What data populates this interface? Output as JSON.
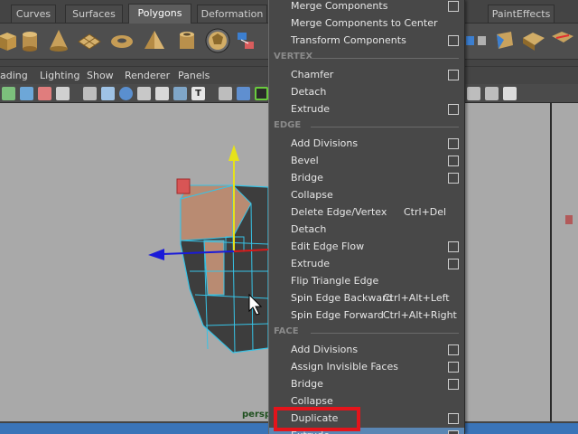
{
  "shelf": {
    "tabs": [
      "Curves",
      "Surfaces",
      "Polygons",
      "Deformation",
      "PaintEffects"
    ],
    "active_tab": "Polygons"
  },
  "panel_menu": [
    "ading",
    "Lighting",
    "Show",
    "Renderer",
    "Panels"
  ],
  "viewport": {
    "camera": "persp"
  },
  "menu": {
    "items": [
      {
        "label": "Merge Components",
        "option_box": true
      },
      {
        "label": "Merge Components to Center",
        "option_box": false
      },
      {
        "label": "Transform Components",
        "option_box": true
      },
      {
        "section": "VERTEX"
      },
      {
        "label": "Chamfer",
        "option_box": true
      },
      {
        "label": "Detach",
        "option_box": false
      },
      {
        "label": "Extrude",
        "option_box": true
      },
      {
        "section": "EDGE"
      },
      {
        "label": "Add Divisions",
        "option_box": true
      },
      {
        "label": "Bevel",
        "option_box": true
      },
      {
        "label": "Bridge",
        "option_box": true
      },
      {
        "label": "Collapse",
        "option_box": false
      },
      {
        "label": "Delete Edge/Vertex",
        "shortcut": "Ctrl+Del",
        "option_box": false
      },
      {
        "label": "Detach",
        "option_box": false
      },
      {
        "label": "Edit Edge Flow",
        "option_box": true
      },
      {
        "label": "Extrude",
        "option_box": true
      },
      {
        "label": "Flip Triangle Edge",
        "option_box": false
      },
      {
        "label": "Spin Edge Backward",
        "shortcut": "Ctrl+Alt+Left",
        "option_box": false
      },
      {
        "label": "Spin Edge Forward",
        "shortcut": "Ctrl+Alt+Right",
        "option_box": false
      },
      {
        "section": "FACE"
      },
      {
        "label": "Add Divisions",
        "option_box": true
      },
      {
        "label": "Assign Invisible Faces",
        "option_box": true
      },
      {
        "label": "Bridge",
        "option_box": true
      },
      {
        "label": "Collapse",
        "option_box": false
      },
      {
        "label": "Duplicate",
        "option_box": true
      },
      {
        "label": "Extrude",
        "option_box": true,
        "highlighted": true
      }
    ]
  },
  "colors": {
    "highlight": "#5a86b4",
    "annotation": "#e4141b",
    "wireframe": "#37c3e6",
    "viewport_bg": "#a9a9a9"
  }
}
